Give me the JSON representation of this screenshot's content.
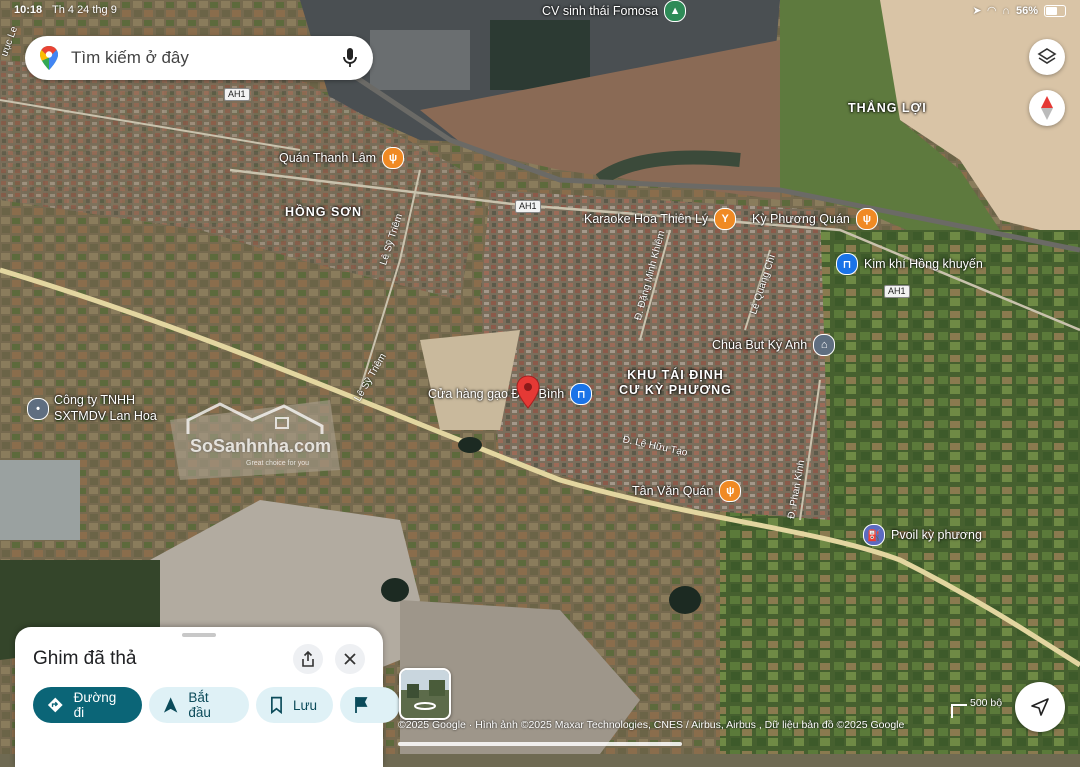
{
  "status_bar": {
    "time": "10:18",
    "date": "Th 4 24 thg 9",
    "battery": "56%"
  },
  "search": {
    "placeholder": "Tìm kiếm ở đây"
  },
  "map_labels": {
    "area_hong_son": "HỒNG SƠN",
    "area_thang_loi": "THẮNG LỢI",
    "area_khu_tai_dinh_cu": [
      "KHU TÁI ĐỊNH",
      "CƯ KỲ PHƯƠNG"
    ],
    "road_le_sy_triem_1": "Lê Sỹ Triêm",
    "road_le_sy_triem_2": "Lê Sỹ Triêm",
    "road_dang_minh_khiem": "Đ. Đặng Minh Khiêm",
    "road_le_quang_chi": "Lê Quang Chí",
    "road_le_huu_tao": "Đ. Lê Hữu Tạo",
    "road_phan_kinh": "Đ. Phan Kính",
    "road_top_left": "ưục Le",
    "shield_1": "AH1",
    "shield_2": "AH1",
    "shield_3": "AH1"
  },
  "pois": {
    "cv_fomosa": "CV sinh thái Fomosa",
    "quan_thanh_lam": "Quán Thanh Lâm",
    "karaoke": "Karaoke Hoa Thiên Lý",
    "ky_phuong_quan": "Kỳ Phương Quán",
    "kim_khi": "Kim khí Hồng khuyến",
    "chua_but": "Chùa Bụt Kỳ Anh",
    "cua_hang_gao": "Cửa hàng gạo Đức Bình",
    "tan_van_quan": "Tân Văn Quán",
    "pvoil": "Pvoil kỳ phương",
    "cong_ty": [
      "Công ty TNHH",
      "SXTMDV Lan Hoa"
    ]
  },
  "watermark": {
    "brand": "SoSanhnha.com",
    "tagline": "Great choice for you"
  },
  "sheet": {
    "title": "Ghim đã thả",
    "buttons": {
      "directions": "Đường đi",
      "start": "Bắt đầu",
      "save": "Lưu"
    }
  },
  "attribution": "©2025 Google · Hình ảnh ©2025 Maxar Technologies, CNES / Airbus, Airbus , Dữ liệu bản đồ ©2025 Google",
  "scale": "500 bộ",
  "colors": {
    "accent": "#0b6577",
    "chip_bg": "#dff1f6",
    "pin": "#e53935",
    "food": "#f08a24",
    "shop": "#1a73e8",
    "worship": "#5f6e80",
    "gas": "#5c6bc0"
  }
}
